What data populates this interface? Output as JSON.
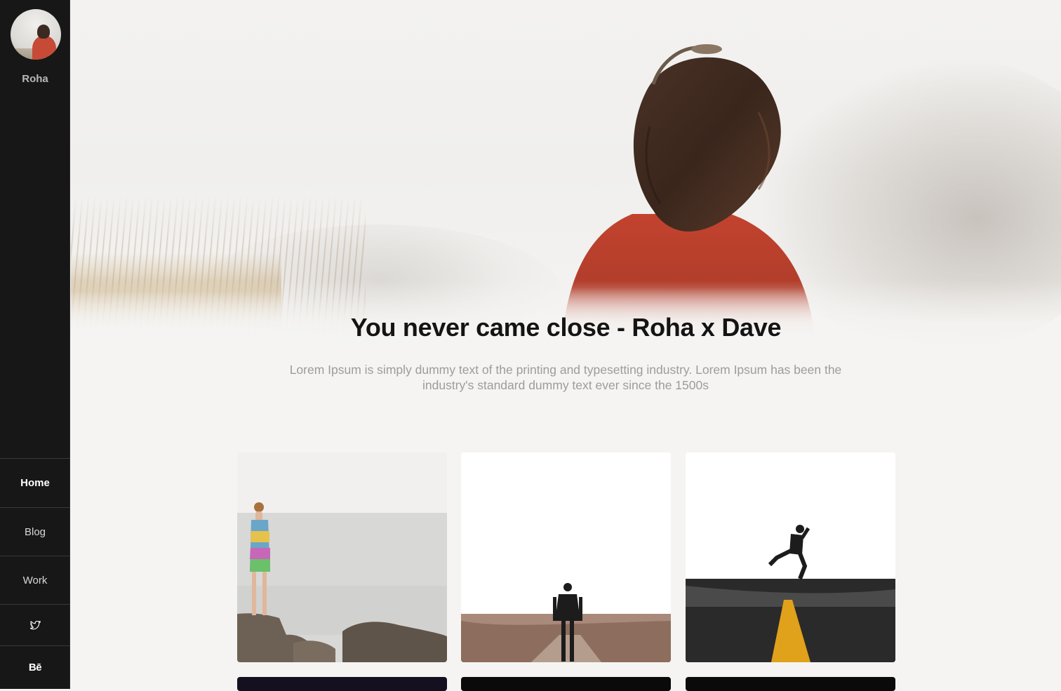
{
  "sidebar": {
    "profile_name": "Roha",
    "nav": [
      {
        "label": "Home",
        "active": true
      },
      {
        "label": "Blog",
        "active": false
      },
      {
        "label": "Work",
        "active": false
      }
    ],
    "social": [
      {
        "icon": "twitter-icon"
      },
      {
        "icon": "behance-icon",
        "text": "Bē"
      }
    ]
  },
  "hero": {
    "title": "You never came close - Roha x Dave",
    "subtitle": "Lorem Ipsum is simply dummy text of the printing and typesetting industry. Lorem Ipsum has been the industry's standard dummy text ever since the 1500s"
  },
  "gallery": [
    {
      "name": "girl-by-sea"
    },
    {
      "name": "man-in-fog"
    },
    {
      "name": "man-jumping-road"
    }
  ],
  "colors": {
    "sidebar_bg": "#171717",
    "page_bg": "#f5f4f2",
    "title": "#141414",
    "subtitle": "#9c9c9c"
  }
}
